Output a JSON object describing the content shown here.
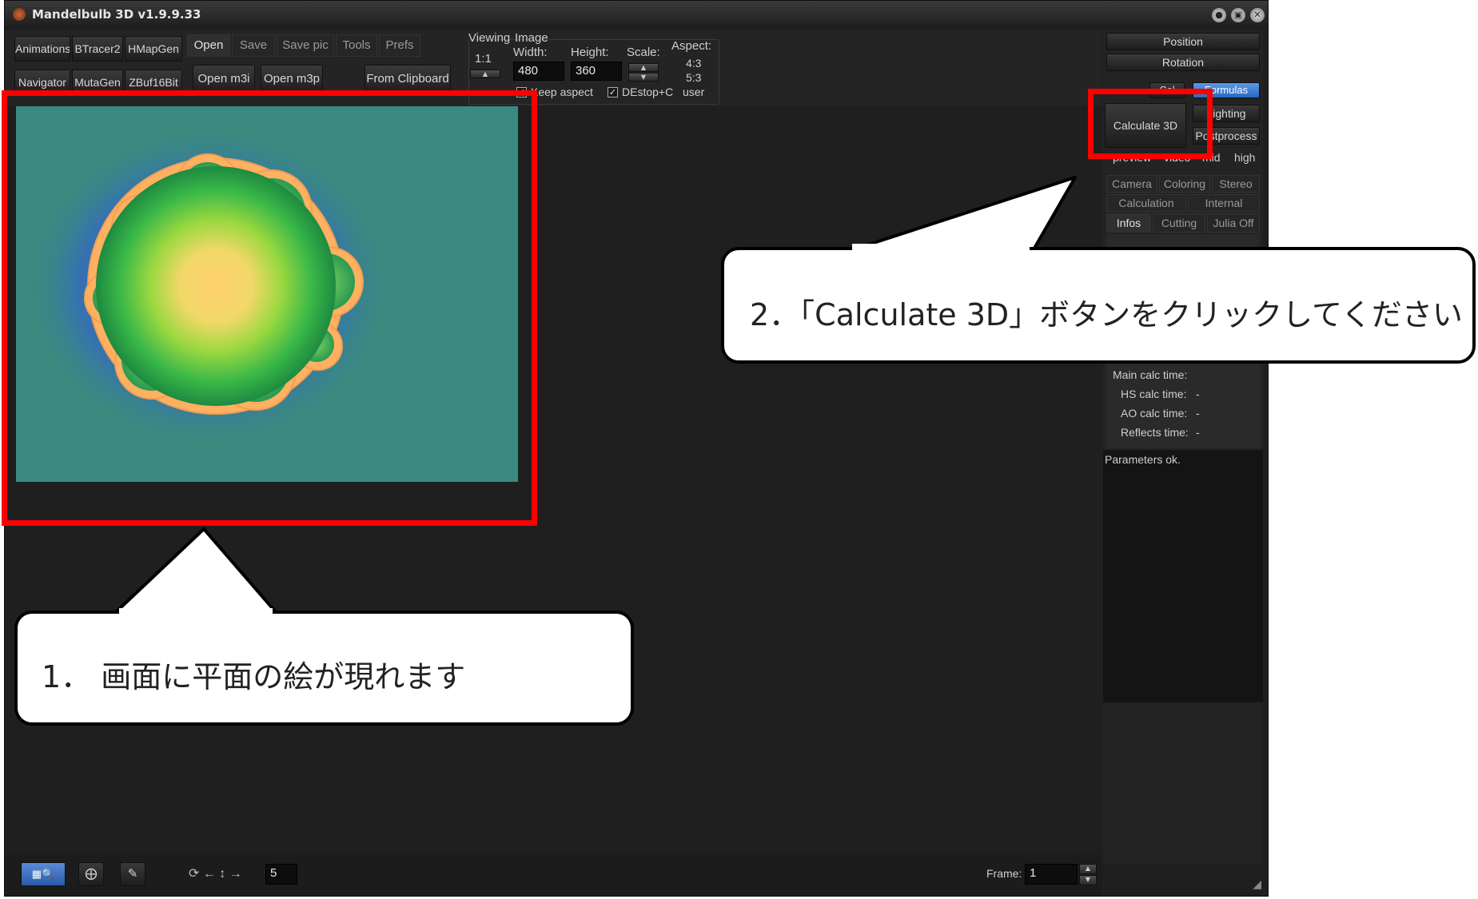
{
  "window": {
    "title": "Mandelbulb 3D    v1.9.9.33",
    "controls": [
      "●",
      "▣",
      "✕"
    ]
  },
  "toolbar": {
    "left_buttons_row1": [
      "Animations",
      "BTracer2",
      "HMapGen"
    ],
    "left_buttons_row2": [
      "Navigator",
      "MutaGen",
      "ZBuf16Bit"
    ],
    "tabs": [
      "Open",
      "Save",
      "Save pic",
      "Tools",
      "Prefs"
    ],
    "open_buttons": [
      "Open m3i",
      "Open m3p",
      "From Clipboard"
    ],
    "viewing": {
      "label": "Viewing",
      "ratio": "1:1"
    },
    "image": {
      "label": "Image",
      "width_label": "Width:",
      "width_value": "480",
      "height_label": "Height:",
      "height_value": "360",
      "scale_label": "Scale:",
      "keep_aspect": "Keep aspect",
      "destop": "DEstop+C"
    },
    "aspect": {
      "label": "Aspect:",
      "options": [
        "4:3",
        "5:3",
        "user"
      ]
    }
  },
  "right_panel": {
    "position_button": "Position",
    "rotation_button": "Rotation",
    "row_small": [
      "Col",
      "Formulas"
    ],
    "calculate_button": "Calculate 3D",
    "side_buttons": [
      "Lighting",
      "Postprocess"
    ],
    "quality": [
      "preview",
      "video",
      "mid",
      "high"
    ],
    "tabs_row1": [
      "Camera",
      "Coloring",
      "Stereo"
    ],
    "tabs_row2": [
      "Calculation",
      "Internal"
    ],
    "tabs_row3": [
      "Infos",
      "Cutting",
      "Julia Off"
    ],
    "times": [
      {
        "label": "Main calc time:",
        "value": ""
      },
      {
        "label": "HS calc time:",
        "value": "-"
      },
      {
        "label": "AO calc time:",
        "value": "-"
      },
      {
        "label": "Reflects time:",
        "value": "-"
      }
    ],
    "status": "Parameters ok."
  },
  "bottom": {
    "step_value": "5",
    "frame_label": "Frame:",
    "frame_value": "1"
  },
  "annotations": {
    "callout1": "1． 画面に平面の絵が現れます",
    "callout2": "2．「Calculate 3D」ボタンをクリックしてください"
  },
  "colors": {
    "highlight": "#ff0000",
    "formulas_tab": "#3a78d0",
    "fractal_bg": "#3a8a80"
  }
}
